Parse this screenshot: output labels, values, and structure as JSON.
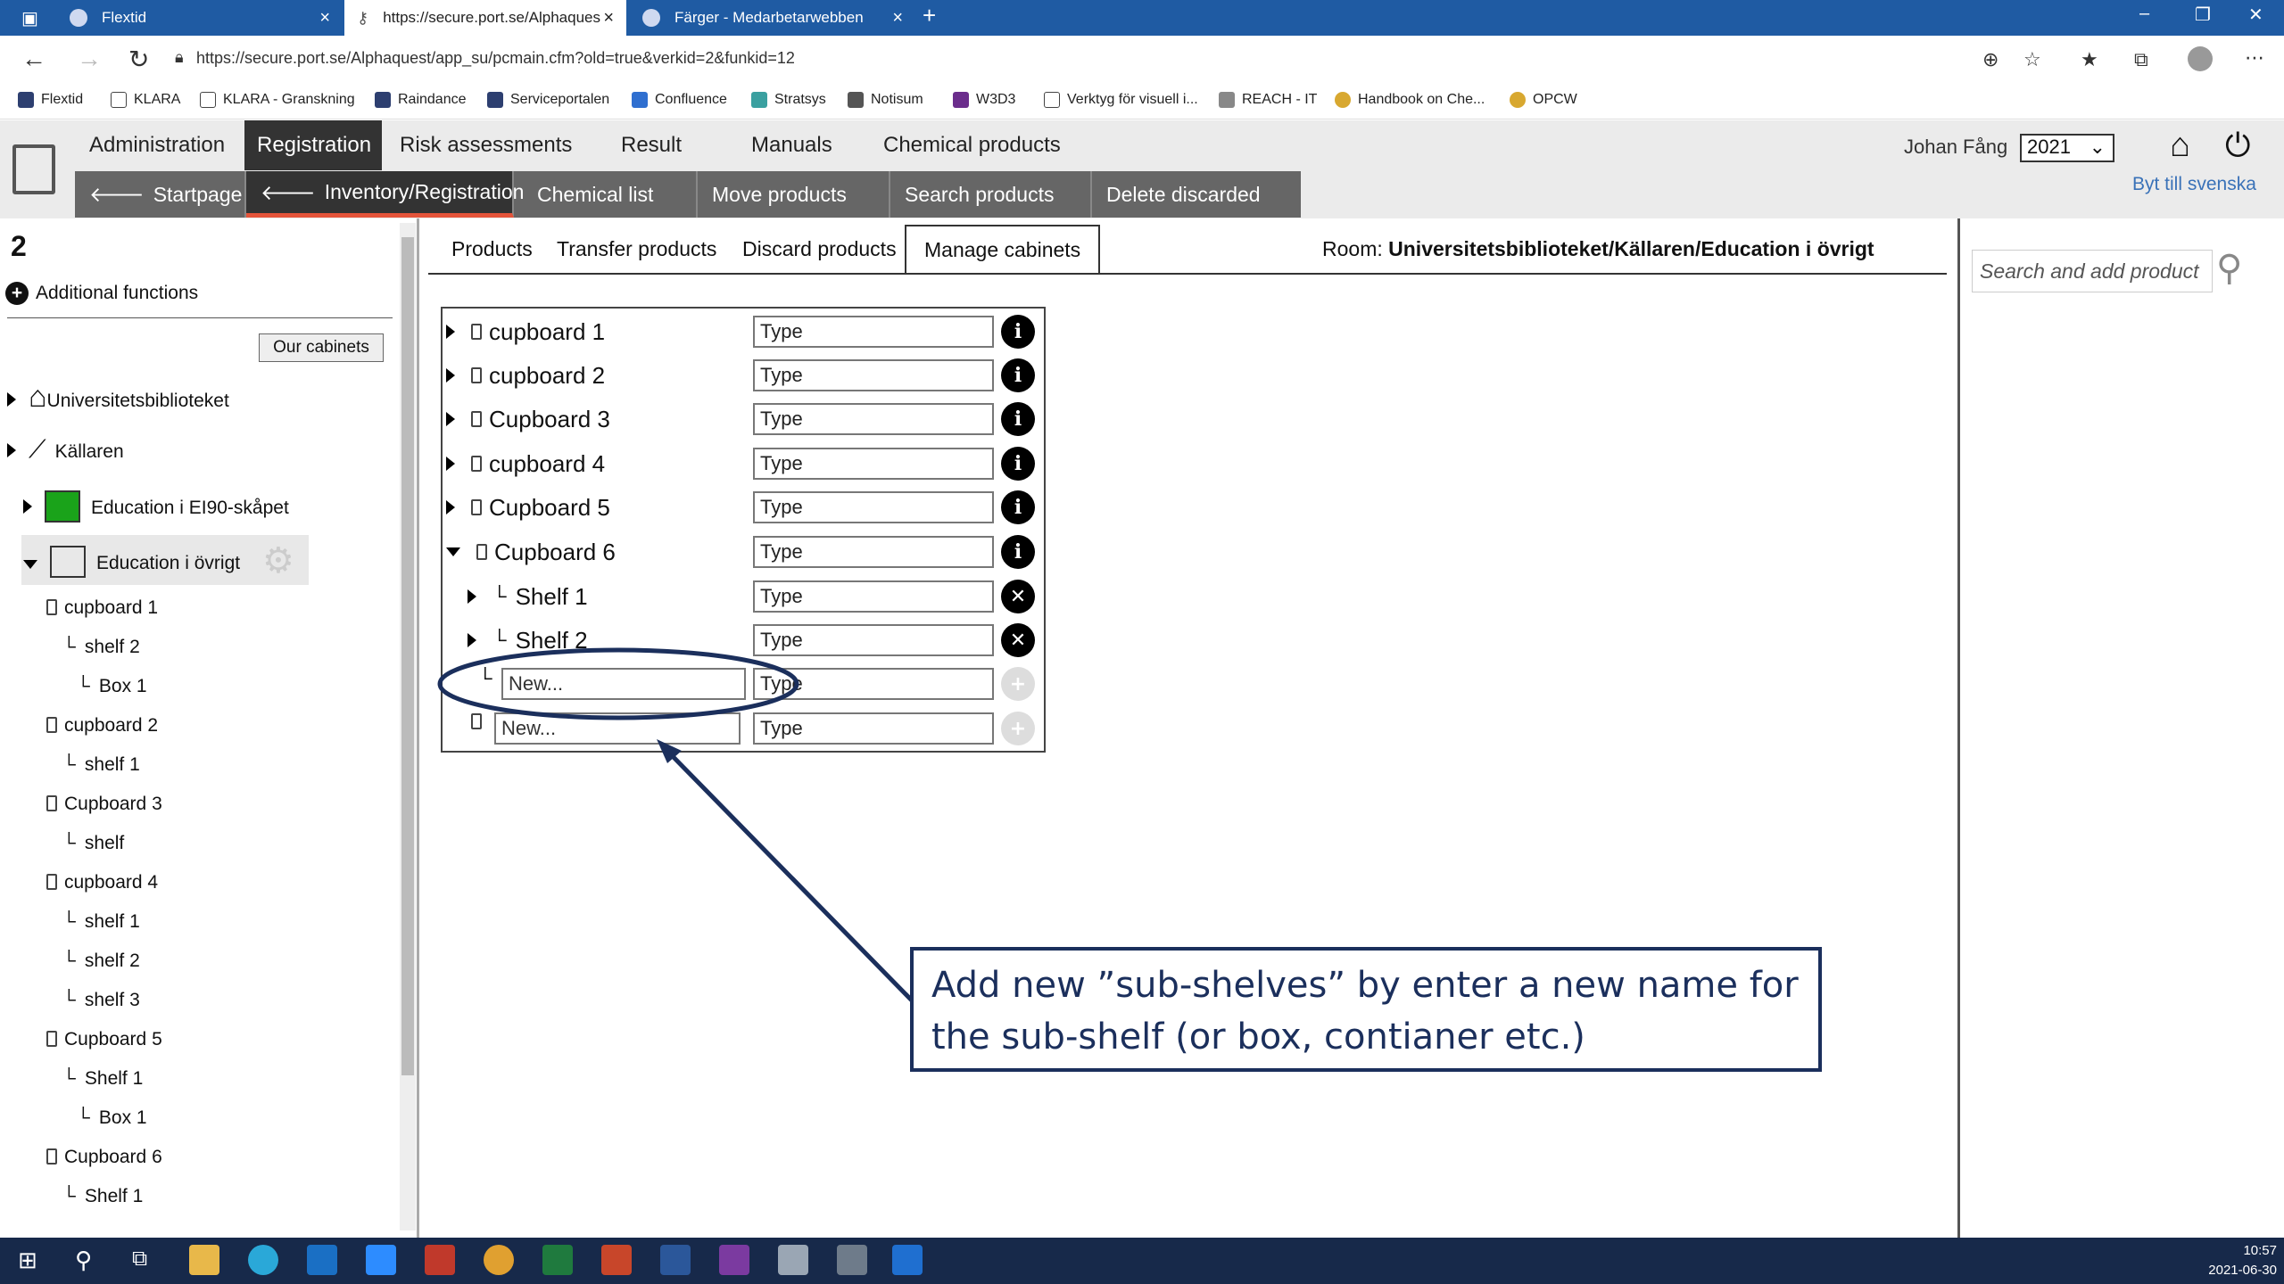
{
  "browser": {
    "tabs": [
      {
        "title": "Flextid"
      },
      {
        "title": "https://secure.port.se/Alphaques"
      },
      {
        "title": "Färger - Medarbetarwebben"
      }
    ],
    "url": "https://secure.port.se/Alphaquest/app_su/pcmain.cfm?old=true&verkid=2&funkid=12",
    "bookmarks": [
      "Flextid",
      "KLARA",
      "KLARA - Granskning",
      "Raindance",
      "Serviceportalen",
      "Confluence",
      "Stratsys",
      "Notisum",
      "W3D3",
      "Verktyg för visuell i...",
      "REACH - IT",
      "Handbook on Che...",
      "OPCW"
    ]
  },
  "header": {
    "main_menu": [
      "Administration",
      "Registration",
      "Risk assessments",
      "Result",
      "Manuals",
      "Chemical products"
    ],
    "sub_menu": [
      "Startpage",
      "Inventory/Registration",
      "Chemical list",
      "Move products",
      "Search products",
      "Delete discarded"
    ],
    "user": "Johan Fång",
    "year": "2021",
    "switch_lang": "Byt till svenska"
  },
  "left": {
    "number": "2",
    "additional": "Additional functions",
    "our_cabinets": "Our cabinets",
    "tree": {
      "root": "Universitetsbiblioteket",
      "floor": "Källaren",
      "room1": "Education i EI90-skåpet",
      "room2": "Education i övrigt"
    },
    "items": [
      "cupboard 1",
      "shelf 2",
      "Box 1",
      "cupboard 2",
      "shelf 1",
      "Cupboard 3",
      "shelf",
      "cupboard 4",
      "shelf 1",
      "shelf 2",
      "shelf 3",
      "Cupboard 5",
      "Shelf 1",
      "Box 1",
      "Cupboard 6",
      "Shelf 1"
    ]
  },
  "main": {
    "tabs": [
      "Products",
      "Transfer products",
      "Discard products",
      "Manage cabinets"
    ],
    "room_label": "Room:",
    "room_path": "Universitetsbiblioteket/Källaren/Education i övrigt",
    "cabinets": [
      "cupboard 1",
      "cupboard 2",
      "Cupboard 3",
      "cupboard 4",
      "Cupboard 5",
      "Cupboard 6"
    ],
    "shelves": [
      "Shelf 1",
      "Shelf 2"
    ],
    "type_placeholder": "Type",
    "new_placeholder": "New..."
  },
  "search_placeholder": "Search and add product",
  "callout": {
    "line1": "Add new ”sub-shelves” by enter a new name for",
    "line2": "the sub-shelf (or box, contianer etc.)"
  },
  "clock": {
    "time": "10:57",
    "date": "2021-06-30"
  },
  "colors": {
    "accent": "#e4543a",
    "callout": "#1b2f5c",
    "tabbar": "#1f5ba3"
  }
}
